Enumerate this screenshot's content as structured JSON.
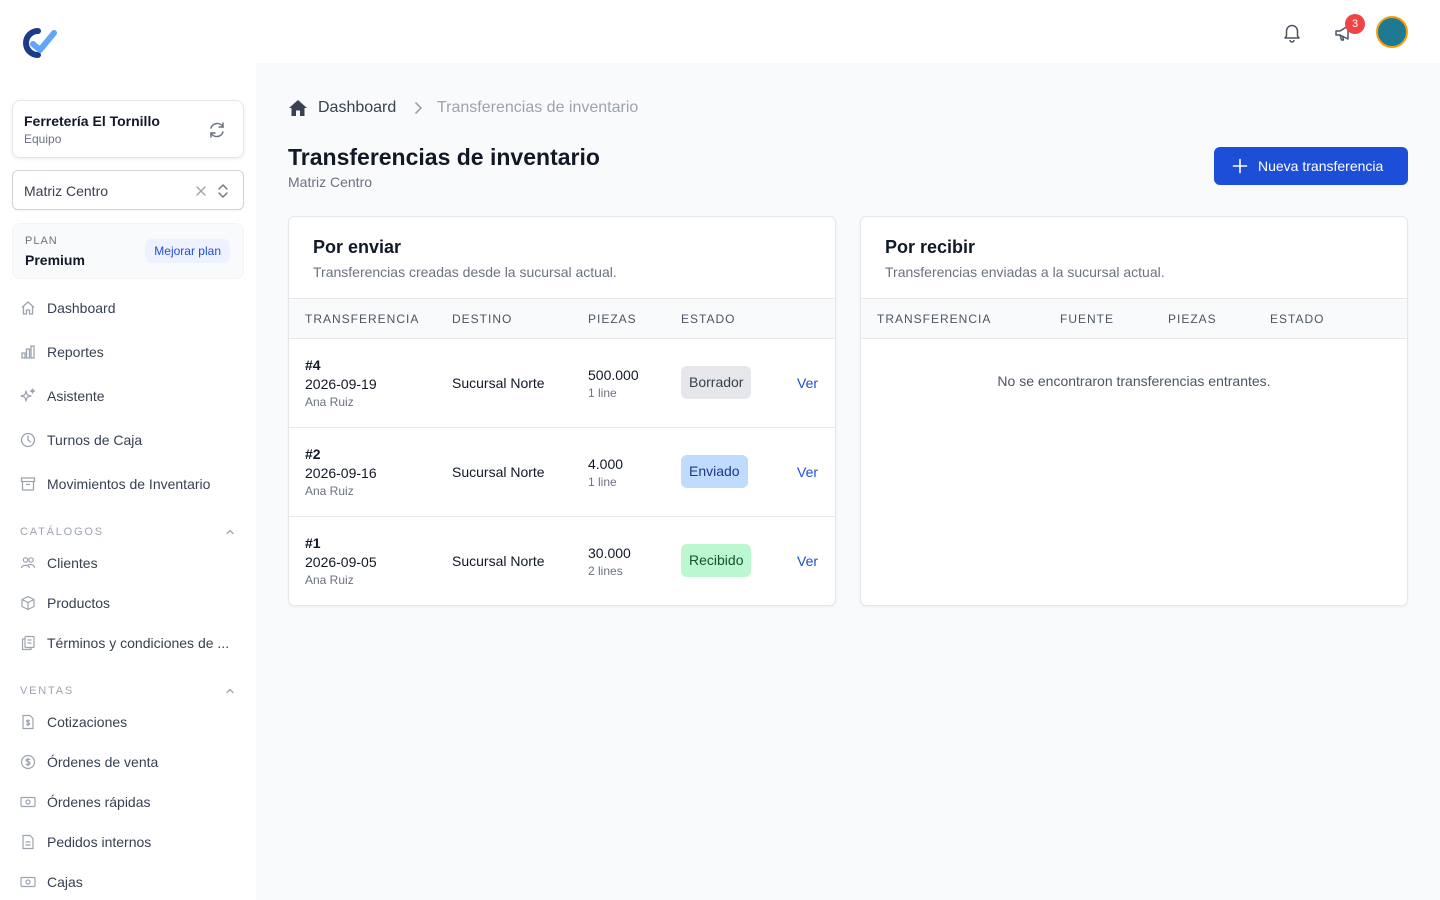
{
  "sidebar": {
    "team": {
      "name": "Ferretería El Tornillo",
      "role": "Equipo"
    },
    "branch": "Matriz Centro",
    "plan": {
      "label": "PLAN",
      "name": "Premium",
      "upgrade": "Mejorar plan"
    },
    "main_items": [
      {
        "label": "Dashboard",
        "icon": "home-icon"
      },
      {
        "label": "Reportes",
        "icon": "chart-icon"
      },
      {
        "label": "Asistente",
        "icon": "sparkles-icon"
      },
      {
        "label": "Turnos de Caja",
        "icon": "clock-icon"
      },
      {
        "label": "Movimientos de Inventario",
        "icon": "archive-icon"
      }
    ],
    "catalogs_title": "CATÁLOGOS",
    "catalog_items": [
      {
        "label": "Clientes",
        "icon": "users-icon"
      },
      {
        "label": "Productos",
        "icon": "cube-icon"
      },
      {
        "label": "Términos y condiciones de ...",
        "icon": "documents-icon"
      }
    ],
    "sales_title": "VENTAS",
    "sales_items": [
      {
        "label": "Cotizaciones",
        "icon": "document-dollar-icon"
      },
      {
        "label": "Órdenes de venta",
        "icon": "dollar-circle-icon"
      },
      {
        "label": "Órdenes rápidas",
        "icon": "cash-icon"
      },
      {
        "label": "Pedidos internos",
        "icon": "document-icon"
      },
      {
        "label": "Cajas",
        "icon": "register-icon"
      }
    ]
  },
  "topbar": {
    "notification_count": "3"
  },
  "breadcrumb": {
    "home": "Dashboard",
    "current": "Transferencias de inventario"
  },
  "page": {
    "title": "Transferencias de inventario",
    "subtitle": "Matriz Centro",
    "new_button": "Nueva transferencia"
  },
  "outgoing": {
    "title": "Por enviar",
    "subtitle": "Transferencias creadas desde la sucursal actual.",
    "headers": [
      "TRANSFERENCIA",
      "DESTINO",
      "PIEZAS",
      "ESTADO"
    ],
    "rows": [
      {
        "id": "#4",
        "date": "2026-09-19",
        "user": "Ana Ruiz",
        "destination": "Sucursal Norte",
        "pieces": "500.000",
        "lines": "1 line",
        "status": "Borrador",
        "action": "Ver"
      },
      {
        "id": "#2",
        "date": "2026-09-16",
        "user": "Ana Ruiz",
        "destination": "Sucursal Norte",
        "pieces": "4.000",
        "lines": "1 line",
        "status": "Enviado",
        "action": "Ver"
      },
      {
        "id": "#1",
        "date": "2026-09-05",
        "user": "Ana Ruiz",
        "destination": "Sucursal Norte",
        "pieces": "30.000",
        "lines": "2 lines",
        "status": "Recibido",
        "action": "Ver"
      }
    ]
  },
  "incoming": {
    "title": "Por recibir",
    "subtitle": "Transferencias enviadas a la sucursal actual.",
    "headers": [
      "TRANSFERENCIA",
      "FUENTE",
      "PIEZAS",
      "ESTADO"
    ],
    "empty": "No se encontraron transferencias entrantes."
  },
  "colors": {
    "primary": "#1d4ed8",
    "badge": "#ef4444",
    "draft": "#e5e7eb",
    "sent": "#bfdbfe",
    "received": "#bbf7d0"
  }
}
